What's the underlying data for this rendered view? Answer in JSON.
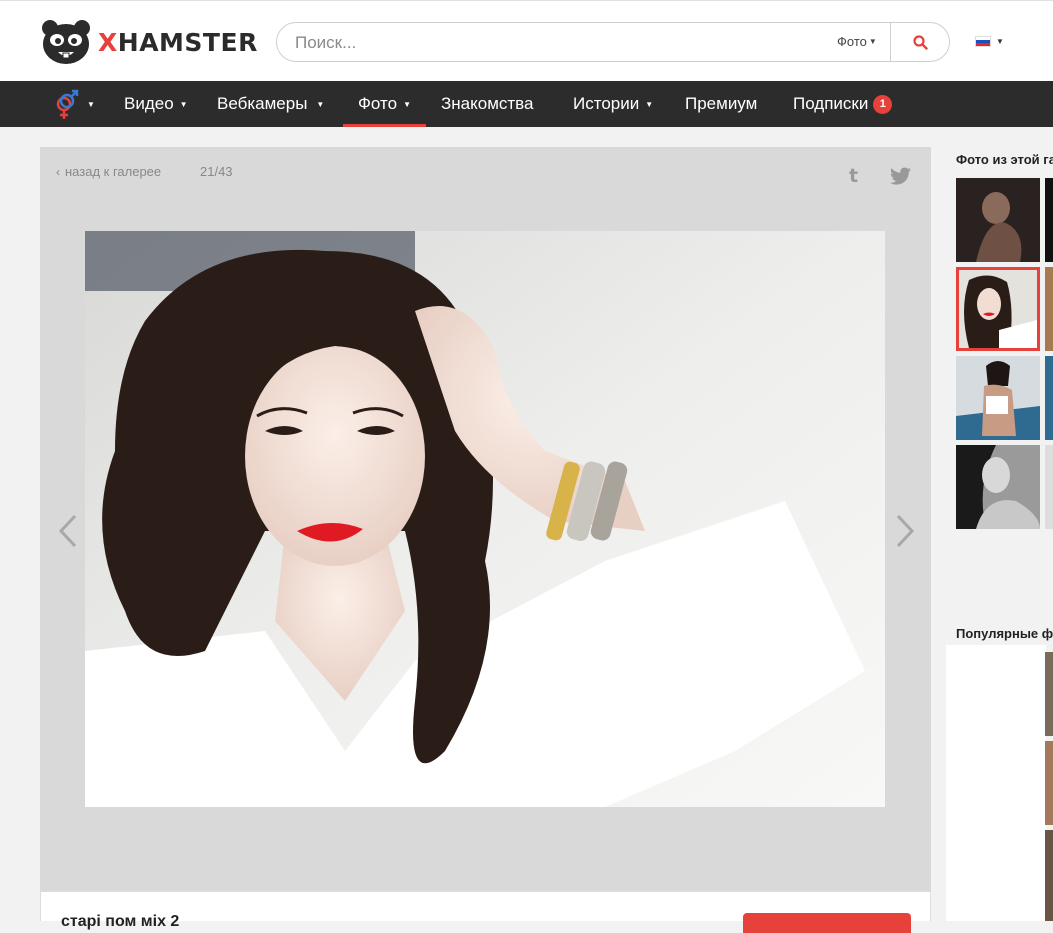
{
  "header": {
    "logo_text": "HAMSTER",
    "logo_x": "X",
    "search_placeholder": "Поиск...",
    "search_category": "Фото",
    "language": "ru"
  },
  "nav": {
    "items": [
      {
        "label": "Видео",
        "dropdown": true
      },
      {
        "label": "Вебкамеры",
        "dropdown": true
      },
      {
        "label": "Фото",
        "dropdown": true,
        "active": true
      },
      {
        "label": "Знакомства",
        "dropdown": false
      },
      {
        "label": "Истории",
        "dropdown": true
      },
      {
        "label": "Премиум",
        "dropdown": false
      },
      {
        "label": "Подписки",
        "dropdown": false,
        "badge": "1"
      }
    ]
  },
  "viewer": {
    "back_label": "назад к галерее",
    "counter": "21/43"
  },
  "gallery": {
    "title": "старі пом міх 2"
  },
  "sidebar": {
    "gallery_title": "Фото из этой га",
    "popular_title": "Популярные ф"
  },
  "colors": {
    "accent": "#e6413b",
    "nav_bg": "#2c2c2c",
    "viewer_bg": "#d9d9d9"
  }
}
